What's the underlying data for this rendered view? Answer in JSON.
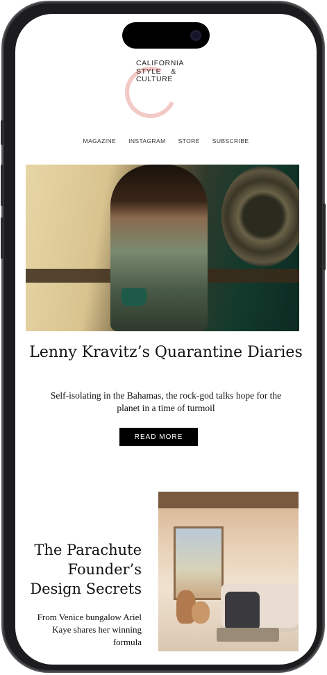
{
  "brand": {
    "logo_text": "CALIFORNIA\nSTYLE    &\nCULTURE"
  },
  "nav": {
    "items": [
      "MAGAZINE",
      "INSTAGRAM",
      "STORE",
      "SUBSCRIBE"
    ]
  },
  "feature": {
    "headline": "Lenny Kravitz’s Quarantine Diaries",
    "subtitle": "Self-isolating in the Bahamas, the rock-god talks hope for the planet in a time of turmoil",
    "button_label": "READ MORE"
  },
  "second_article": {
    "headline": "The Parachute Founder’s Design Secrets",
    "subtitle": "From Venice bungalow Ariel Kaye shares her winning formula"
  },
  "colors": {
    "logo_accent": "#f3c9c6",
    "button_bg": "#000000",
    "text": "#111111"
  }
}
